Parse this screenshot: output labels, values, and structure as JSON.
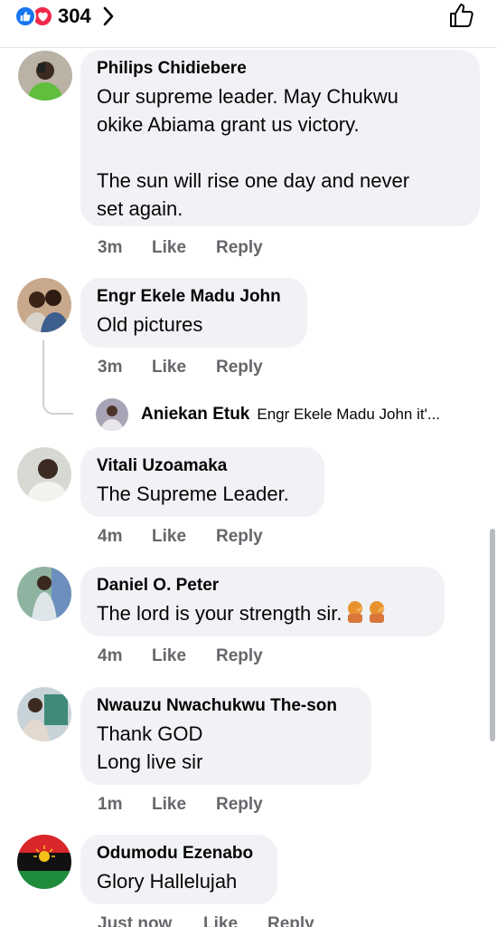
{
  "header": {
    "reaction_count": "304",
    "icons": [
      "like-reaction-icon",
      "love-reaction-icon",
      "chevron-right-icon",
      "thumbs-up-outline-icon"
    ],
    "colors": {
      "like": "#1877f2",
      "love": "#f02849"
    }
  },
  "comments": [
    {
      "author": "Philips Chidiebere",
      "text": "Our supreme leader. May Chukwu\nokike Abiama grant us victory.\n\nThe sun will rise one day and never\nset again.",
      "time": "3m",
      "like_label": "Like",
      "reply_label": "Reply"
    },
    {
      "author": "Engr Ekele Madu John",
      "text": "Old pictures",
      "time": "3m",
      "like_label": "Like",
      "reply_label": "Reply",
      "reply_preview": {
        "author": "Aniekan Etuk",
        "text": "Engr Ekele Madu John it'..."
      }
    },
    {
      "author": "Vitali Uzoamaka",
      "text": "The Supreme Leader.",
      "time": "4m",
      "like_label": "Like",
      "reply_label": "Reply"
    },
    {
      "author": "Daniel O. Peter",
      "text": "The lord is your strength sir.",
      "emoji": "person-facepalming-emoji x2",
      "time": "4m",
      "like_label": "Like",
      "reply_label": "Reply"
    },
    {
      "author": "Nwauzu Nwachukwu The-son",
      "text": "Thank GOD\nLong live sir",
      "time": "1m",
      "like_label": "Like",
      "reply_label": "Reply"
    },
    {
      "author": "Odumodu Ezenabo",
      "text": "Glory Hallelujah",
      "time": "Just now",
      "like_label": "Like",
      "reply_label": "Reply"
    }
  ]
}
